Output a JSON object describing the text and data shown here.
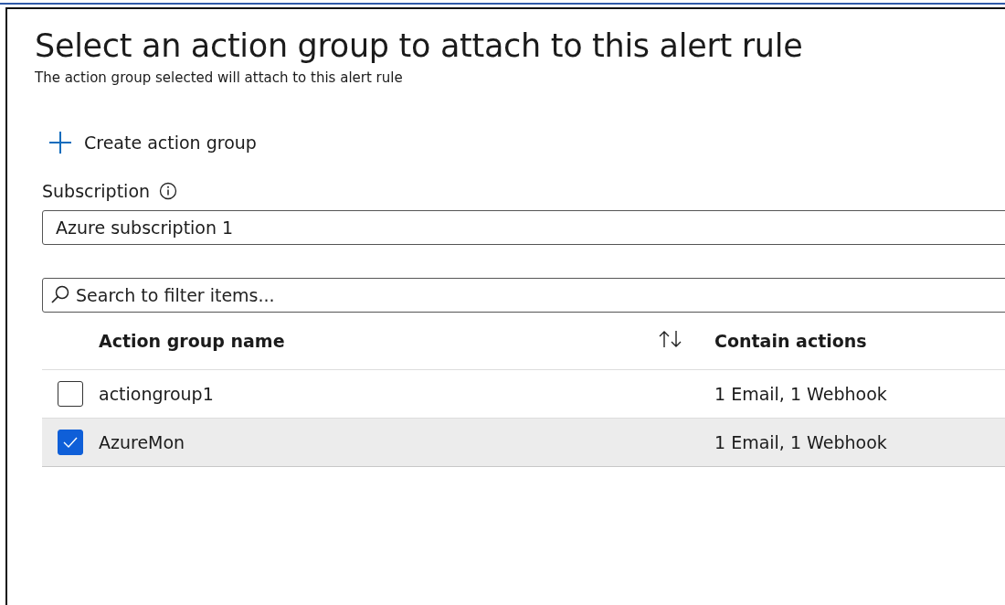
{
  "title": "Select an action group to attach to this alert rule",
  "subtitle": "The action group selected will attach to this alert rule",
  "create_button": {
    "label": "Create action group"
  },
  "subscription": {
    "label": "Subscription",
    "value": "Azure subscription 1"
  },
  "search": {
    "placeholder": "Search to filter items..."
  },
  "table": {
    "columns": [
      "Action group name",
      "Contain actions"
    ],
    "rows": [
      {
        "name": "actiongroup1",
        "actions": "1 Email, 1 Webhook",
        "selected": false
      },
      {
        "name": "AzureMon",
        "actions": "1 Email, 1 Webhook",
        "selected": true
      }
    ]
  }
}
